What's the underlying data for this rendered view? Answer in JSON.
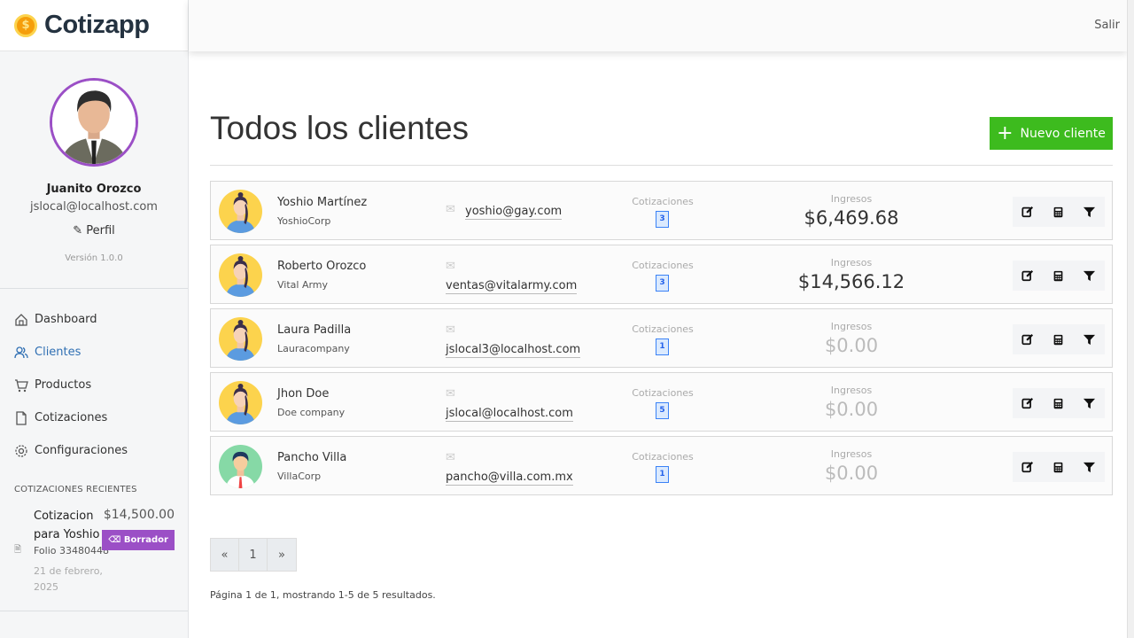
{
  "app": {
    "name": "Cotizapp",
    "logout": "Salir"
  },
  "profile": {
    "name": "Juanito Orozco",
    "email": "jslocal@localhost.com",
    "profile_link": "Perfil",
    "version": "Versión 1.0.0"
  },
  "nav": [
    {
      "label": "Dashboard",
      "icon": "home-icon"
    },
    {
      "label": "Clientes",
      "icon": "users-icon",
      "active": true
    },
    {
      "label": "Productos",
      "icon": "cart-icon"
    },
    {
      "label": "Cotizaciones",
      "icon": "file-icon"
    },
    {
      "label": "Configuraciones",
      "icon": "gear-icon"
    }
  ],
  "recent": {
    "heading": "COTIZACIONES RECIENTES",
    "items": [
      {
        "title": "Cotizacion para Yoshio",
        "folio": "Folio 33480448",
        "date": "21 de febrero, 2025",
        "amount": "$14,500.00",
        "status": "Borrador"
      }
    ]
  },
  "page": {
    "title": "Todos los clientes",
    "new_button": "Nuevo cliente",
    "quotes_label": "Cotizaciones",
    "income_label": "Ingresos"
  },
  "clients": [
    {
      "name": "Yoshio Martínez",
      "company": "YoshioCorp",
      "email": "yoshio@gay.com",
      "quotes": "3",
      "income": "$6,469.68",
      "avatar": "female"
    },
    {
      "name": "Roberto Orozco",
      "company": "Vital Army",
      "email": "ventas@vitalarmy.com",
      "quotes": "3",
      "income": "$14,566.12",
      "avatar": "female"
    },
    {
      "name": "Laura Padilla",
      "company": "Lauracompany",
      "email": "jslocal3@localhost.com",
      "quotes": "1",
      "income": "$0.00",
      "avatar": "female"
    },
    {
      "name": "Jhon Doe",
      "company": "Doe company",
      "email": "jslocal@localhost.com",
      "quotes": "5",
      "income": "$0.00",
      "avatar": "female"
    },
    {
      "name": "Pancho Villa",
      "company": "VillaCorp",
      "email": "pancho@villa.com.mx",
      "quotes": "1",
      "income": "$0.00",
      "avatar": "male"
    }
  ],
  "pagination": {
    "prev": "«",
    "current": "1",
    "next": "»",
    "info": "Página 1 de 1, mostrando 1-5 de 5 resultados."
  },
  "colors": {
    "accent": "#3dbb1e",
    "active_nav": "#2f6fb3",
    "draft": "#9b4fc6"
  }
}
